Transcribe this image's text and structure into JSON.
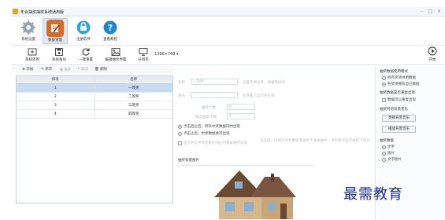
{
  "window": {
    "title": "年会抽奖抽奖系统通用版"
  },
  "ribbon": {
    "tabs": [
      {
        "label": "系统设置",
        "icon": "gear-icon"
      },
      {
        "label": "数据管理",
        "icon": "edit-icon"
      },
      {
        "label": "注册软件",
        "icon": "register-icon"
      },
      {
        "label": "查看教程",
        "icon": "help-icon"
      }
    ]
  },
  "toolbar": {
    "items": [
      {
        "label": "系统还原",
        "icon": "restore-icon"
      },
      {
        "label": "系统备份",
        "icon": "backup-icon"
      },
      {
        "label": "一键重置",
        "icon": "reset-icon"
      },
      {
        "label": "编辑抽奖界面",
        "icon": "image-icon"
      },
      {
        "label": "分辨率",
        "icon": "monitor-icon"
      }
    ],
    "resolution": "1366×768  ▾",
    "start_label": "开始"
  },
  "actions": {
    "add": "⊕ 添加",
    "edit": "✎ 修改",
    "save": "🖫 保存",
    "cancel": "↶ 取消",
    "delete": "🗑 删除"
  },
  "table": {
    "headers": [
      "排号",
      "名称"
    ],
    "rows": [
      {
        "no": "1",
        "name": "一等奖"
      },
      {
        "no": "2",
        "name": "二等奖"
      },
      {
        "no": "3",
        "name": "三等奖"
      },
      {
        "no": "4",
        "name": "四等奖"
      }
    ]
  },
  "form": {
    "name_label": "名称",
    "name_value": "一等奖",
    "name_hint": "设置奖项名称，请谨慎操作",
    "alias_label": "别名",
    "alias_hint": "在界面上显示的名称",
    "draw_count_label": "抽奖个数",
    "draw_count_value": "0",
    "per_draw_label": "每次抽取个数",
    "per_draw_value": "1",
    "radio1": "点击后止后，所有中奖数据同时出现",
    "radio2": "点击止后，中奖数据依次出现",
    "check_hint_a": "是否开启中奖结果的对应的重复抽奖标准",
    "check_hint_b": "勾选后，同组内中奖数据重复时不会被抽中，中奖者的名字会如下显示",
    "bg_title": "抽奖背景图片"
  },
  "right_panel": {
    "mode_title": "抽奖数据使用模式",
    "mode_opt1": "所有奖项共用数据",
    "mode_opt2": "各奖项拥有自己数据",
    "dup_title": "抽奖数据是否重复出现",
    "dup_check": "数据可以重复出现",
    "music_title": "抽奖时的背景音乐",
    "btn_change_music": "更换背景音乐",
    "btn_play_music": "播放背景音乐",
    "data_title": "抽奖数据",
    "data_opt1": "文字",
    "data_opt2": "图片",
    "data_opt3": "文字图片"
  },
  "watermark": "最需教育"
}
